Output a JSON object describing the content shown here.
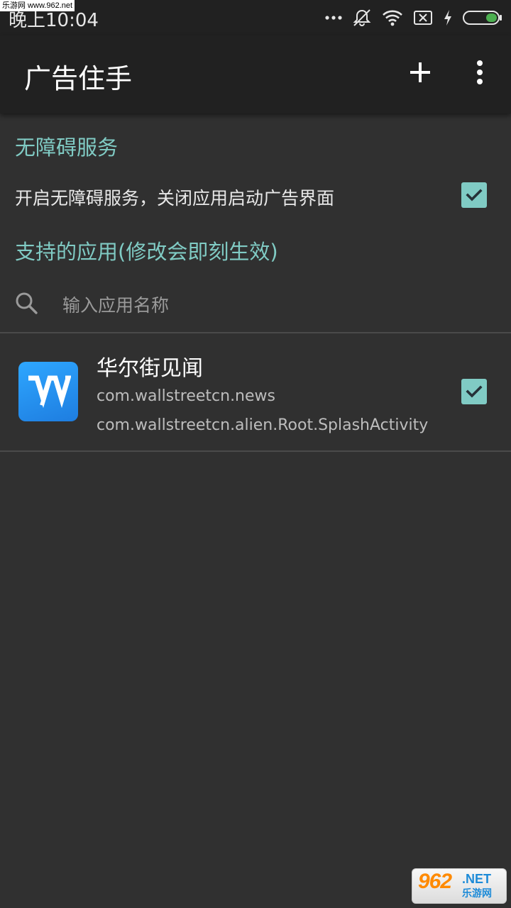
{
  "status_bar": {
    "time": "晚上10:04",
    "watermark": "乐游网 www.962.net",
    "icons": [
      "more-dots-icon",
      "silent-bell-icon",
      "wifi-icon",
      "no-sim-icon",
      "charging-bolt-icon",
      "battery-icon"
    ],
    "battery_color": "#4caf50"
  },
  "app_bar": {
    "title": "广告住手",
    "actions": [
      "add-icon",
      "more-vert-icon"
    ]
  },
  "accessibility": {
    "header": "无障碍服务",
    "toggle_label": "开启无障碍服务，关闭应用启动广告界面",
    "toggle_checked": true
  },
  "supported_apps": {
    "header": "支持的应用(修改会即刻生效)",
    "search_placeholder": "输入应用名称",
    "search_value": "",
    "items": [
      {
        "name": "华尔街见闻",
        "package": "com.wallstreetcn.news",
        "activity": "com.wallstreetcn.alien.Root.SplashActivity",
        "checked": true,
        "icon": "wallstreetcn-app-icon"
      }
    ]
  },
  "watermark_logo": {
    "number": "962",
    "suffix": ".NET",
    "text": "乐游网"
  },
  "colors": {
    "accent": "#80cbc4",
    "toolbar": "#212121",
    "background": "#303030",
    "divider": "#4a4a4a"
  }
}
